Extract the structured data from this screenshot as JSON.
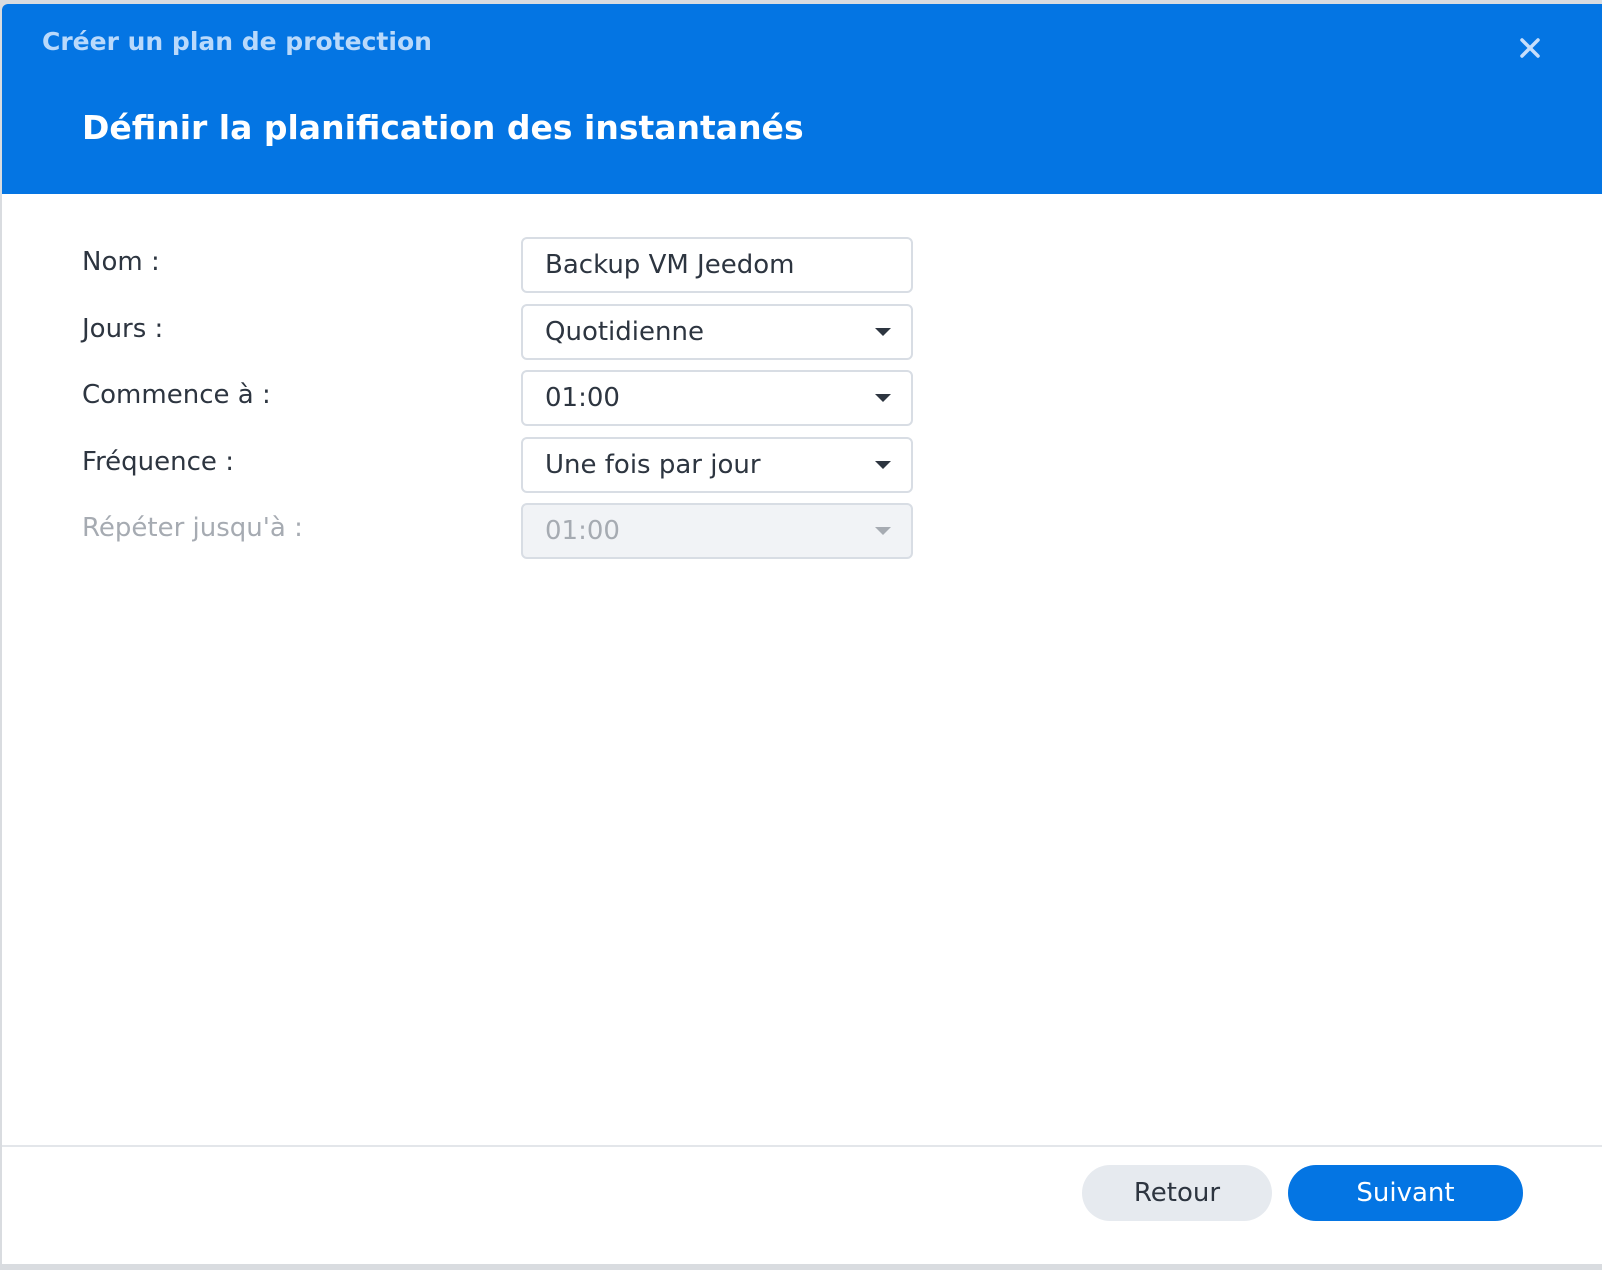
{
  "header": {
    "window_title": "Créer un plan de protection",
    "step_title": "Définir la planification des instantanés",
    "close_icon": "close-icon"
  },
  "form": {
    "name": {
      "label": "Nom :",
      "value": "Backup VM Jeedom"
    },
    "days": {
      "label": "Jours :",
      "value": "Quotidienne"
    },
    "starts_at": {
      "label": "Commence à :",
      "value": "01:00"
    },
    "frequency": {
      "label": "Fréquence :",
      "value": "Une fois par jour"
    },
    "repeat_until": {
      "label": "Répéter jusqu'à :",
      "value": "01:00",
      "disabled": true
    }
  },
  "footer": {
    "back_label": "Retour",
    "next_label": "Suivant"
  },
  "colors": {
    "accent": "#0475e3",
    "header_subtitle": "#b9d9fb",
    "text": "#2d3540",
    "disabled_text": "#a6abb2"
  }
}
